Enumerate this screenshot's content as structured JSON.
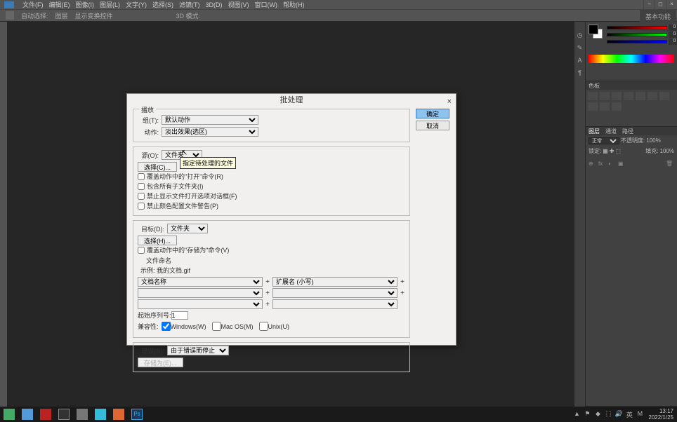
{
  "menubar": {
    "items": [
      "文件(F)",
      "编辑(E)",
      "图像(I)",
      "图层(L)",
      "文字(Y)",
      "选择(S)",
      "滤镜(T)",
      "3D(D)",
      "视图(V)",
      "窗口(W)",
      "帮助(H)"
    ]
  },
  "options_bar": {
    "items": [
      "自动选择:",
      "图层",
      "显示变换控件",
      "3D 模式:"
    ],
    "right": "基本功能"
  },
  "panels": {
    "swatch_panel": "色板",
    "blend_mode": "正常",
    "opacity_label": "不透明度:",
    "opacity_value": "100%",
    "fill_label": "填充:",
    "fill_value": "100%",
    "lock_label": "锁定:",
    "layer_tabs": [
      "图层",
      "通道",
      "路径"
    ]
  },
  "dialog": {
    "title": "批处理",
    "fieldset_play": "播放",
    "group_label": "组(T):",
    "group_value": "默认动作",
    "action_label": "动作:",
    "action_value": "淡出效果(选区)",
    "source_label": "源(O):",
    "source_value": "文件夹",
    "choose_btn": "选择(C)...",
    "tooltip": "指定待处理的文件",
    "override_open": "覆盖动作中的\"打开\"命令(R)",
    "include_subfolders": "包含所有子文件夹(I)",
    "suppress_open_dialogs": "禁止显示文件打开选项对话框(F)",
    "suppress_color_warnings": "禁止颜色配置文件警告(P)",
    "dest_label": "目标(D):",
    "dest_value": "文件夹",
    "choose_btn2": "选择(H)...",
    "override_save": "覆盖动作中的\"存储为\"命令(V)",
    "filename_heading": "文件命名",
    "example": "示例: 我的文档.gif",
    "name_token1": "文档名称",
    "name_token2": "扩展名 (小写)",
    "start_serial_label": "起始序列号:",
    "start_serial": "1",
    "compat_label": "兼容性:",
    "compat_win": "Windows(W)",
    "compat_mac": "Mac OS(M)",
    "compat_unix": "Unix(U)",
    "errors_label": "错误(B):",
    "errors_value": "由于错误而停止",
    "save_as_btn": "存储为(E)...",
    "ok": "确定",
    "cancel": "取消"
  },
  "tray": {
    "time": "13:17",
    "date": "2022/1/25"
  }
}
